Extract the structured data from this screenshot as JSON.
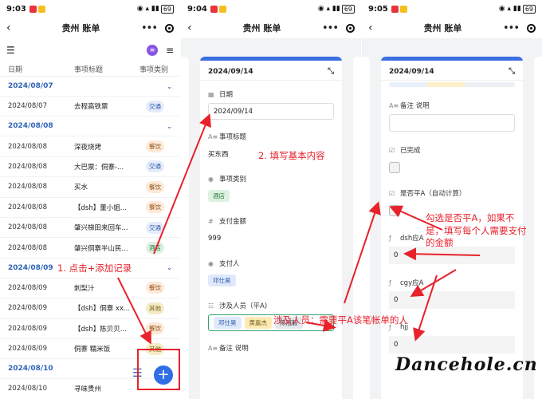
{
  "status": [
    {
      "time": "9:03",
      "battery": "69"
    },
    {
      "time": "9:04",
      "battery": "69"
    },
    {
      "time": "9:05",
      "battery": "69"
    }
  ],
  "app_title": "贵州 账单",
  "list": {
    "avatar_text": "≡",
    "columns": [
      "日期",
      "事项标题",
      "事项类别"
    ],
    "groups": [
      {
        "date": "2024/08/07",
        "rows": [
          {
            "date": "2024/08/07",
            "title": "去程高铁票",
            "category": "交通",
            "cat_class": "jt"
          }
        ]
      },
      {
        "date": "2024/08/08",
        "rows": [
          {
            "date": "2024/08/08",
            "title": "深夜烧烤",
            "category": "餐饮",
            "cat_class": "cy"
          },
          {
            "date": "2024/08/08",
            "title": "大巴票：侗寨-...",
            "category": "交通",
            "cat_class": "jt"
          },
          {
            "date": "2024/08/08",
            "title": "买水",
            "category": "餐饮",
            "cat_class": "cy"
          },
          {
            "date": "2024/08/08",
            "title": "【dsh】董小姐...",
            "category": "餐饮",
            "cat_class": "cy"
          },
          {
            "date": "2024/08/08",
            "title": "肇兴梯田来回车...",
            "category": "交通",
            "cat_class": "jt"
          },
          {
            "date": "2024/08/08",
            "title": "肇兴侗寨半山民...",
            "category": "酒店",
            "cat_class": "jd"
          }
        ]
      },
      {
        "date": "2024/08/09",
        "rows": [
          {
            "date": "2024/08/09",
            "title": "刺梨汁",
            "category": "餐饮",
            "cat_class": "cy"
          },
          {
            "date": "2024/08/09",
            "title": "【dsh】侗寨 xx...",
            "category": "其他",
            "cat_class": "qt"
          },
          {
            "date": "2024/08/09",
            "title": "【dsh】陈贝贝...",
            "category": "餐饮",
            "cat_class": "cy"
          },
          {
            "date": "2024/08/09",
            "title": "侗寨 糯米饭",
            "category": "其他",
            "cat_class": "qt"
          }
        ]
      },
      {
        "date": "2024/08/10",
        "rows": [
          {
            "date": "2024/08/10",
            "title": "寻味贵州",
            "category": "",
            "cat_class": ""
          }
        ]
      }
    ]
  },
  "form1": {
    "header_date": "2024/09/14",
    "date_label": "日期",
    "date_value": "2024/09/14",
    "title_label": "事项标题",
    "title_value": "买东西",
    "category_label": "事项类别",
    "category_value": "酒店",
    "amount_label": "支付金额",
    "amount_value": "999",
    "payer_label": "支付人",
    "payer_value": "邓仕昊",
    "involved_label": "涉及人员（平A)",
    "involved": [
      "邓仕昊",
      "黄嘉杰",
      "陈冠毅"
    ],
    "note_label": "备注 说明"
  },
  "form2": {
    "header_date": "2024/09/14",
    "note_label": "备注 说明",
    "done_label": "已完成",
    "split_label": "是否平A（自动计算）",
    "dsh_label": "dsh应A",
    "dsh_value": "0",
    "cgy_label": "cgy应A",
    "cgy_value": "0",
    "hjj_label": "hjj",
    "hjj_value": "0"
  },
  "annotations": {
    "step1": "1. 点击+添加记录",
    "step2": "2. 填写基本内容",
    "involved": "涉及人员：需要平A该笔帐单的人",
    "split": [
      "勾选是否平A，如果不",
      "是，填写每个人需要支付",
      "的金额"
    ]
  },
  "watermark": "Dancehole.cn",
  "colors": {
    "accent": "#3a6de0",
    "annotation": "#e8212b",
    "fab": "#2f6ee6"
  }
}
